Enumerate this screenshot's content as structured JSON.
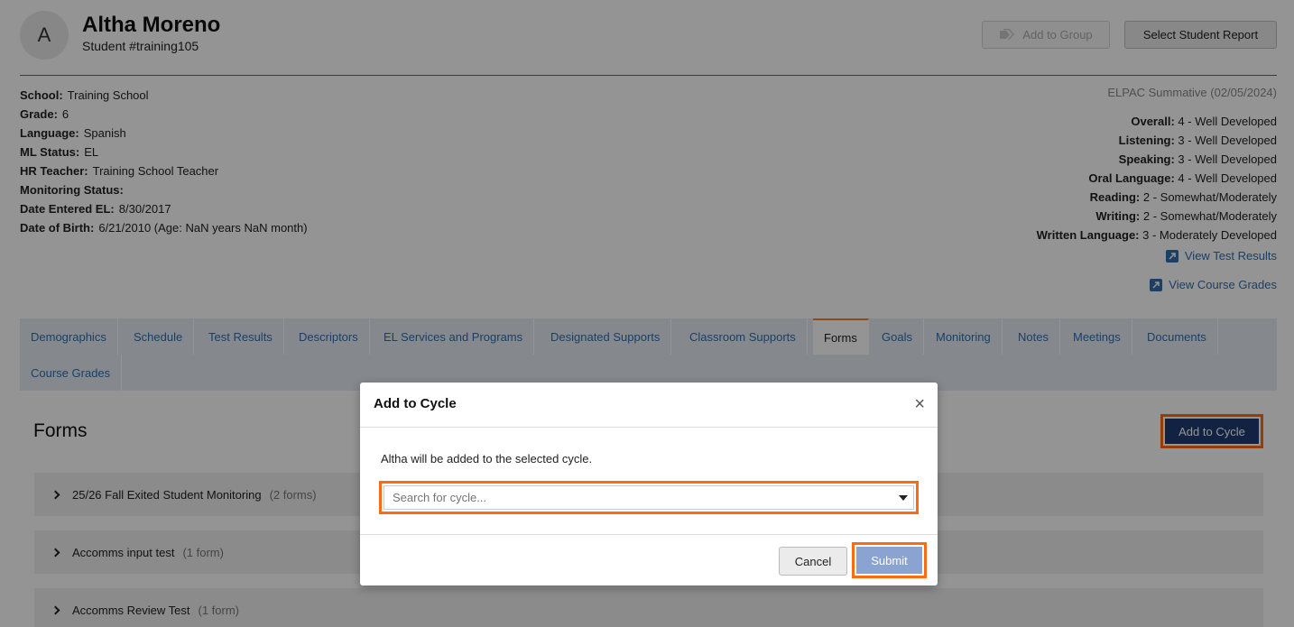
{
  "header": {
    "avatar_initial": "A",
    "name": "Altha Moreno",
    "student_id": "Student #training105",
    "add_to_group_label": "Add to Group",
    "select_report_label": "Select Student Report"
  },
  "info": [
    {
      "label": "School:",
      "value": "Training School"
    },
    {
      "label": "Grade:",
      "value": "6"
    },
    {
      "label": "Language:",
      "value": "Spanish"
    },
    {
      "label": "ML Status:",
      "value": "EL"
    },
    {
      "label": "HR Teacher:",
      "value": "Training School Teacher"
    },
    {
      "label": "Monitoring Status:",
      "value": ""
    },
    {
      "label": "Date Entered EL:",
      "value": "8/30/2017"
    },
    {
      "label": "Date of Birth:",
      "value": "6/21/2010 (Age: NaN years NaN month)"
    }
  ],
  "elpac": {
    "title": "ELPAC Summative (02/05/2024)",
    "scores": [
      {
        "label": "Overall:",
        "value": "4 - Well Developed"
      },
      {
        "label": "Listening:",
        "value": "3 - Well Developed"
      },
      {
        "label": "Speaking:",
        "value": "3 - Well Developed"
      },
      {
        "label": "Oral Language:",
        "value": "4 - Well Developed"
      },
      {
        "label": "Reading:",
        "value": "2 - Somewhat/Moderately"
      },
      {
        "label": "Writing:",
        "value": "2 - Somewhat/Moderately"
      },
      {
        "label": "Written Language:",
        "value": "3 - Moderately Developed"
      }
    ],
    "view_test_results": "View Test Results",
    "view_course_grades": "View Course Grades"
  },
  "tabs": [
    {
      "label": "Demographics"
    },
    {
      "label": "Schedule"
    },
    {
      "label": "Test Results"
    },
    {
      "label": "Descriptors"
    },
    {
      "label": "EL Services and Programs"
    },
    {
      "label": "Designated Supports"
    },
    {
      "label": "Classroom Supports"
    },
    {
      "label": "Forms"
    },
    {
      "label": "Goals"
    },
    {
      "label": "Monitoring"
    },
    {
      "label": "Notes"
    },
    {
      "label": "Meetings"
    },
    {
      "label": "Documents"
    },
    {
      "label": "Course Grades"
    }
  ],
  "forms": {
    "title": "Forms",
    "add_to_cycle_label": "Add to Cycle",
    "items": [
      {
        "name": "25/26 Fall Exited Student Monitoring",
        "count": "(2 forms)"
      },
      {
        "name": "Accomms input test",
        "count": "(1 form)"
      },
      {
        "name": "Accomms Review Test",
        "count": "(1 form)"
      }
    ]
  },
  "modal": {
    "title": "Add to Cycle",
    "close": "×",
    "message": "Altha will be added to the selected cycle.",
    "search_placeholder": "Search for cycle...",
    "cancel_label": "Cancel",
    "submit_label": "Submit"
  }
}
